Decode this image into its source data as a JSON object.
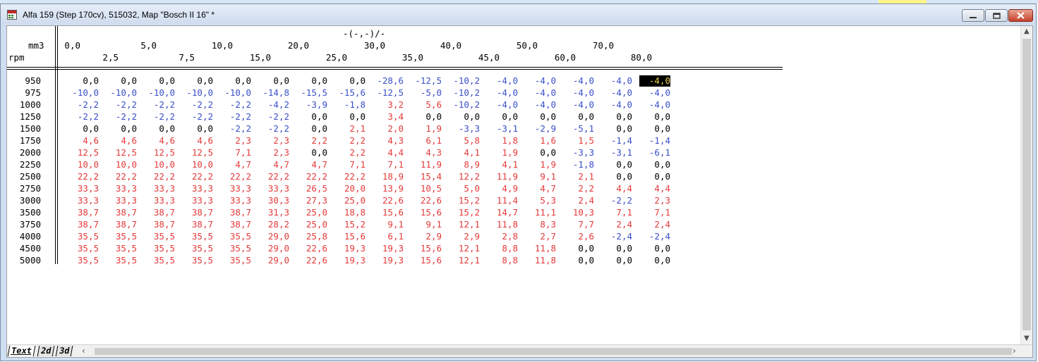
{
  "window": {
    "title": "Alfa 159 (Step 170cv), 515032, Map \"Bosch II 16\" *"
  },
  "map": {
    "title": "-(-,-)/-",
    "x_unit": "mm3",
    "y_unit": "rpm",
    "x_axis": [
      "0,0",
      "2,5",
      "5,0",
      "7,5",
      "10,0",
      "15,0",
      "20,0",
      "25,0",
      "30,0",
      "35,0",
      "40,0",
      "45,0",
      "50,0",
      "60,0",
      "70,0",
      "80,0"
    ],
    "y_axis": [
      "950",
      "975",
      "1000",
      "1250",
      "1500",
      "1750",
      "2000",
      "2250",
      "2500",
      "2750",
      "3000",
      "3500",
      "3750",
      "4000",
      "4500",
      "5000"
    ],
    "values": [
      [
        "0,0",
        "0,0",
        "0,0",
        "0,0",
        "0,0",
        "0,0",
        "0,0",
        "0,0",
        "-28,6",
        "-12,5",
        "-10,2",
        "-4,0",
        "-4,0",
        "-4,0",
        "-4,0",
        "-4,0"
      ],
      [
        "-10,0",
        "-10,0",
        "-10,0",
        "-10,0",
        "-10,0",
        "-14,8",
        "-15,5",
        "-15,6",
        "-12,5",
        "-5,0",
        "-10,2",
        "-4,0",
        "-4,0",
        "-4,0",
        "-4,0",
        "-4,0"
      ],
      [
        "-2,2",
        "-2,2",
        "-2,2",
        "-2,2",
        "-2,2",
        "-4,2",
        "-3,9",
        "-1,8",
        "3,2",
        "5,6",
        "-10,2",
        "-4,0",
        "-4,0",
        "-4,0",
        "-4,0",
        "-4,0"
      ],
      [
        "-2,2",
        "-2,2",
        "-2,2",
        "-2,2",
        "-2,2",
        "-2,2",
        "0,0",
        "0,0",
        "3,4",
        "0,0",
        "0,0",
        "0,0",
        "0,0",
        "0,0",
        "0,0",
        "0,0"
      ],
      [
        "0,0",
        "0,0",
        "0,0",
        "0,0",
        "-2,2",
        "-2,2",
        "0,0",
        "2,1",
        "2,0",
        "1,9",
        "-3,3",
        "-3,1",
        "-2,9",
        "-5,1",
        "0,0",
        "0,0"
      ],
      [
        "4,6",
        "4,6",
        "4,6",
        "4,6",
        "2,3",
        "2,3",
        "2,2",
        "2,2",
        "4,3",
        "6,1",
        "5,8",
        "1,8",
        "1,6",
        "1,5",
        "-1,4",
        "-1,4"
      ],
      [
        "12,5",
        "12,5",
        "12,5",
        "12,5",
        "7,1",
        "2,3",
        "0,0",
        "2,2",
        "4,4",
        "4,3",
        "4,1",
        "1,9",
        "0,0",
        "-3,3",
        "-3,1",
        "-6,1"
      ],
      [
        "10,0",
        "10,0",
        "10,0",
        "10,0",
        "4,7",
        "4,7",
        "4,7",
        "7,1",
        "7,1",
        "11,9",
        "8,9",
        "4,1",
        "1,9",
        "-1,8",
        "0,0",
        "0,0"
      ],
      [
        "22,2",
        "22,2",
        "22,2",
        "22,2",
        "22,2",
        "22,2",
        "22,2",
        "22,2",
        "18,9",
        "15,4",
        "12,2",
        "11,9",
        "9,1",
        "2,1",
        "0,0",
        "0,0"
      ],
      [
        "33,3",
        "33,3",
        "33,3",
        "33,3",
        "33,3",
        "33,3",
        "26,5",
        "20,0",
        "13,9",
        "10,5",
        "5,0",
        "4,9",
        "4,7",
        "2,2",
        "4,4",
        "4,4"
      ],
      [
        "33,3",
        "33,3",
        "33,3",
        "33,3",
        "33,3",
        "30,3",
        "27,3",
        "25,0",
        "22,6",
        "22,6",
        "15,2",
        "11,4",
        "5,3",
        "2,4",
        "-2,2",
        "2,3"
      ],
      [
        "38,7",
        "38,7",
        "38,7",
        "38,7",
        "38,7",
        "31,3",
        "25,0",
        "18,8",
        "15,6",
        "15,6",
        "15,2",
        "14,7",
        "11,1",
        "10,3",
        "7,1",
        "7,1"
      ],
      [
        "38,7",
        "38,7",
        "38,7",
        "38,7",
        "38,7",
        "28,2",
        "25,0",
        "15,2",
        "9,1",
        "9,1",
        "12,1",
        "11,8",
        "8,3",
        "7,7",
        "2,4",
        "2,4"
      ],
      [
        "35,5",
        "35,5",
        "35,5",
        "35,5",
        "35,5",
        "29,0",
        "25,8",
        "15,6",
        "6,1",
        "2,9",
        "2,9",
        "2,8",
        "2,7",
        "2,6",
        "-2,4",
        "-2,4"
      ],
      [
        "35,5",
        "35,5",
        "35,5",
        "35,5",
        "35,5",
        "29,0",
        "22,6",
        "19,3",
        "19,3",
        "15,6",
        "12,1",
        "8,8",
        "11,8",
        "0,0",
        "0,0",
        "0,0"
      ],
      [
        "35,5",
        "35,5",
        "35,5",
        "35,5",
        "35,5",
        "29,0",
        "22,6",
        "19,3",
        "19,3",
        "15,6",
        "12,1",
        "8,8",
        "11,8",
        "0,0",
        "0,0",
        "0,0"
      ]
    ],
    "selected_cell": {
      "row": 0,
      "col": 15
    }
  },
  "tabs": [
    {
      "label": "Text",
      "active": true
    },
    {
      "label": "2d",
      "active": false
    },
    {
      "label": "3d",
      "active": false
    }
  ],
  "colors": {
    "positive": "#e43a3a",
    "negative": "#3a4fc8",
    "zero": "#000000",
    "selected_fg": "#e8d24a",
    "selected_bg": "#000000"
  }
}
